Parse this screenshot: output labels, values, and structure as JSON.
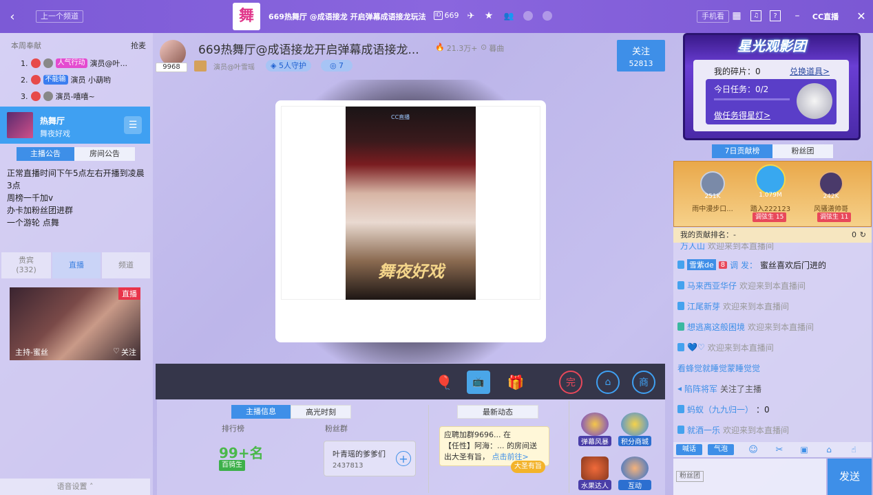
{
  "topbar": {
    "prev_channel": "上一个频道",
    "room_logo_text": "舞",
    "title": "669热舞厅 @成语接龙 开启弹幕成语接龙玩法",
    "room_id": "669",
    "phone_watch": "手机看",
    "brand": "CC直播"
  },
  "left": {
    "rank_header": "本周奉献",
    "rank_action": "抢麦",
    "ranks": [
      {
        "n": "1.",
        "badge": "人气行动",
        "name": "演员@叶..."
      },
      {
        "n": "2.",
        "badge": "不能输",
        "name": "演员 小葫哟"
      },
      {
        "n": "3.",
        "badge": "",
        "name": "演员-嘻嘻~"
      }
    ],
    "channel": {
      "name": "热舞厅",
      "sub": "舞夜好戏"
    },
    "notice_tabs": [
      "主播公告",
      "房间公告"
    ],
    "notice_lines": [
      "正常直播时间下午5点左右开播到凌晨",
      "3点",
      "周榜一千加v",
      "办卡加粉丝团进群",
      "一个游轮 点舞"
    ],
    "sub_tabs": [
      "贵宾",
      "直播",
      "频道"
    ],
    "guest_count": "(332)",
    "live_badge": "直播",
    "host_label": "主持-蜜丝",
    "follow_label": "关注",
    "voice_settings": "语音设置"
  },
  "streamer": {
    "title": "669热舞厅@成语接龙开启弹幕成语接龙...",
    "heat": "21.3万+",
    "replay": "暮曲",
    "level": "9968",
    "anchor": "演员@叶雪瑶",
    "guard": "5人守护",
    "fans": "7",
    "follow": "关注",
    "follow_count": "52813"
  },
  "poster": {
    "brand": "CC直播",
    "title": "舞夜好戏"
  },
  "info": {
    "tabs": [
      "主播信息",
      "高光时刻"
    ],
    "rank_label": "排行榜",
    "fans_label": "粉丝群",
    "rank_value": "99+名",
    "rank_tag": "百骑生",
    "fans_group": "叶青瑶的爹爹们",
    "fans_id": "2437813",
    "news_tab": "最新动态",
    "news_text1": "应聘加群9696...",
    "news_text1b": "在",
    "news_text2": "【任性】阿海：...",
    "news_text2b": "的房间送",
    "news_text3": "出大圣有旨，",
    "news_link": "点击前往>",
    "news_badge": "大圣有旨"
  },
  "actions": [
    {
      "label": "弹幕风暴"
    },
    {
      "label": "积分商城"
    },
    {
      "label": "水果达人"
    },
    {
      "label": "互动"
    }
  ],
  "right": {
    "banner_title": "星光观影团",
    "fragments": "我的碎片：0",
    "exchange": "兑换道具>",
    "tasks": "今日任务：0/2",
    "task_link": "做任务得星灯>",
    "tabs": [
      "7日贡献榜",
      "粉丝团"
    ],
    "podium": [
      {
        "score": "251K",
        "name": "雨中漫步口...",
        "tag": ""
      },
      {
        "score": "1.079M",
        "name": "踏入222123",
        "tag": "调弦生 15"
      },
      {
        "score": "242K",
        "name": "风骚潇帅哥",
        "tag": "调弦生 11"
      }
    ],
    "my_rank": "我的贡献排名：",
    "my_rank_val": "-",
    "my_score": "0",
    "chat": [
      {
        "user": "万人山",
        "msg": "欢迎来到本直播间"
      },
      {
        "user": "雪紫de",
        "lvl": "8",
        "user2": "调 发：",
        "msg": "蜜丝喜欢后门进的"
      },
      {
        "user": "马来西亚华仔",
        "msg": "欢迎来到本直播间"
      },
      {
        "user": "江尾新芽",
        "msg": "欢迎来到本直播间"
      },
      {
        "user": "想逃离这般困境",
        "msg": "欢迎来到本直播间"
      },
      {
        "user": "",
        "msg": "欢迎来到本直播间"
      },
      {
        "user": "看蜂觉就睡觉蒙睡觉觉",
        "msg": ""
      },
      {
        "user": "陷阵将军",
        "msg": "关注了主播"
      },
      {
        "user": "蚂蚁（九九归一）",
        "msg": "：0"
      },
      {
        "user": "就酒一乐",
        "msg": "欢迎来到本直播间"
      }
    ],
    "chat_tools": [
      "喊话",
      "气泡"
    ],
    "fan_club": "粉丝团",
    "send": "发送"
  }
}
